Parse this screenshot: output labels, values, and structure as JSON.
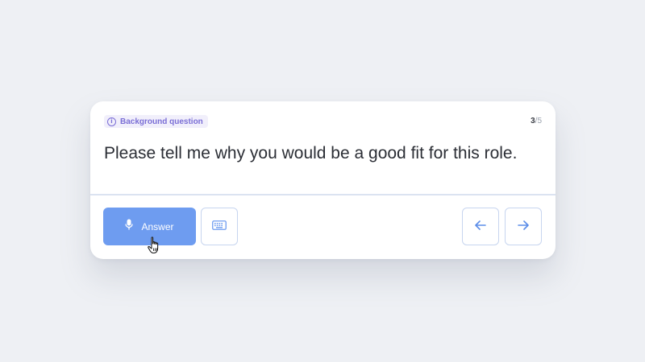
{
  "card": {
    "tag_label": "Background question",
    "tag_icon": "info-icon",
    "counter": {
      "current": "3",
      "separator": "/",
      "total": "5"
    },
    "question": "Please tell me why you would be a good fit for this role."
  },
  "actions": {
    "answer_label": "Answer",
    "answer_icon": "microphone-icon",
    "keyboard_icon": "keyboard-icon",
    "prev_icon": "arrow-left-icon",
    "next_icon": "arrow-right-icon"
  },
  "colors": {
    "accent": "#6e9cf0",
    "tag_purple": "#7b6fd6",
    "background": "#eef0f4"
  }
}
